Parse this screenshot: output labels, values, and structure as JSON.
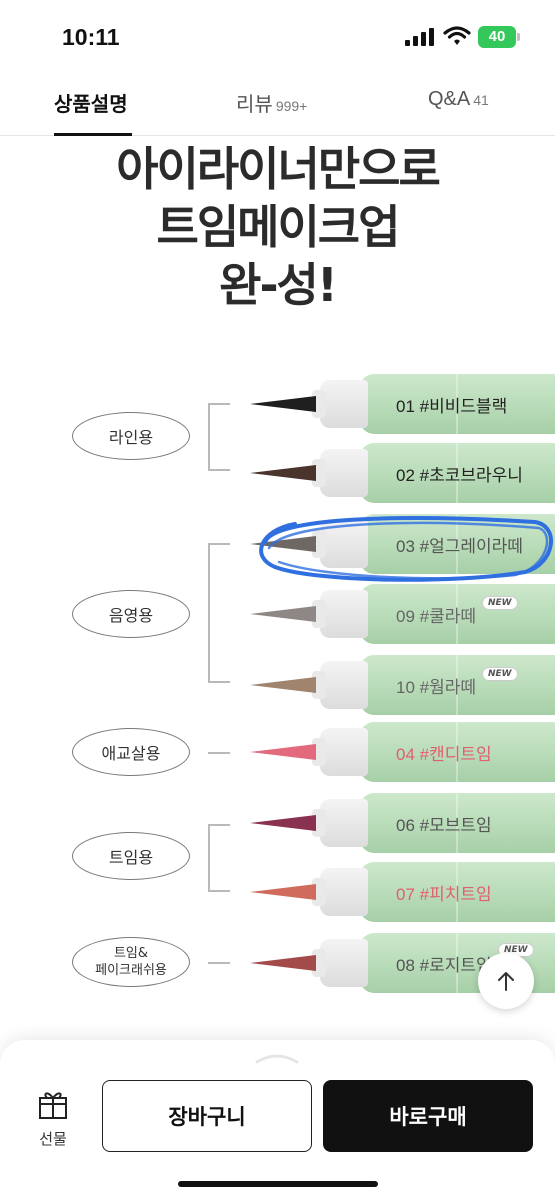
{
  "status": {
    "time": "10:11",
    "battery": "40"
  },
  "tabs": [
    {
      "label": "상품설명",
      "count": ""
    },
    {
      "label": "리뷰",
      "count": "999+"
    },
    {
      "label": "Q&A",
      "count": "41"
    }
  ],
  "hero": {
    "line1": "아이라이너만으로",
    "line2": "트임메이크업",
    "line3": "완-성!"
  },
  "groups": [
    {
      "label": "라인용"
    },
    {
      "label": "음영용"
    },
    {
      "label": "애교살용"
    },
    {
      "label": "트임용"
    },
    {
      "label": "트임&\n페이크래쉬용"
    }
  ],
  "shades": [
    {
      "name": "01 #비비드블랙",
      "tip_color": "#1f1f1f",
      "text_color": "#222222",
      "new": false
    },
    {
      "name": "02 #초코브라우니",
      "tip_color": "#4a342b",
      "text_color": "#222222",
      "new": false
    },
    {
      "name": "03 #얼그레이라떼",
      "tip_color": "#6f6763",
      "text_color": "#555555",
      "new": false
    },
    {
      "name": "09 #쿨라떼",
      "tip_color": "#8e8785",
      "text_color": "#666666",
      "new": true
    },
    {
      "name": "10 #웜라떼",
      "tip_color": "#a0846e",
      "text_color": "#666666",
      "new": true
    },
    {
      "name": "04 #캔디트임",
      "tip_color": "#e36a7c",
      "text_color": "#e0606e",
      "new": false
    },
    {
      "name": "06 #모브트임",
      "tip_color": "#8a3050",
      "text_color": "#555555",
      "new": false
    },
    {
      "name": "07 #피치트임",
      "tip_color": "#d06c5e",
      "text_color": "#e0606e",
      "new": false
    },
    {
      "name": "08 #로지트임",
      "tip_color": "#a34a4a",
      "text_color": "#555555",
      "new": true
    }
  ],
  "new_badge": "NEW",
  "bottom": {
    "gift_label": "선물",
    "cart_label": "장바구니",
    "buy_label": "바로구매"
  },
  "colors": {
    "accent_green": "#34c759",
    "pen_body": "#b6dab6",
    "scribble_blue": "#2f6fe0"
  }
}
